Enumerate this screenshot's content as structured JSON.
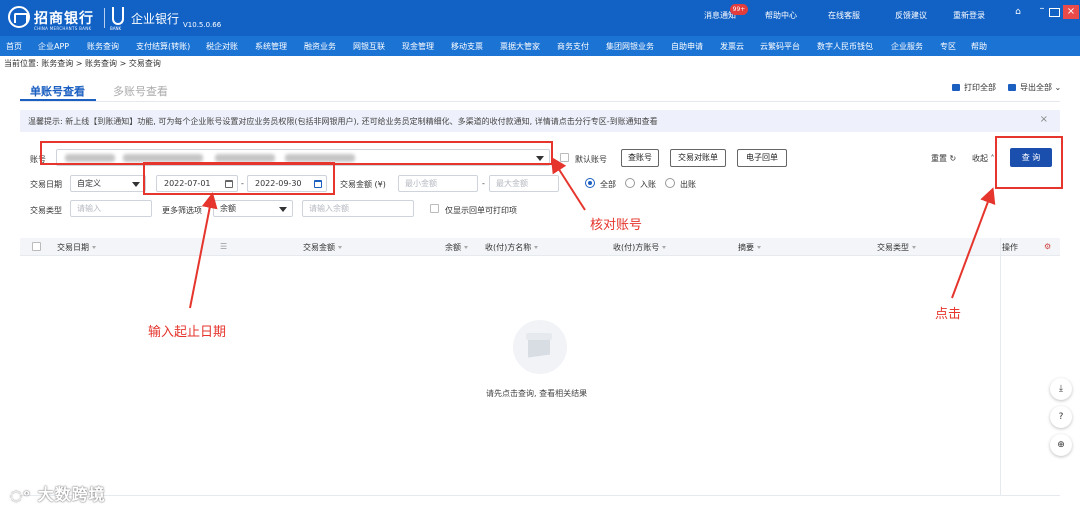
{
  "titlebar": {
    "bank_name": "招商银行",
    "bank_en": "CHINA MERCHANTS BANK",
    "ebank_sub": "BANK",
    "ebank_name": "企业银行",
    "version": "V10.5.0.66",
    "links": [
      "消息通知",
      "帮助中心",
      "在线客服",
      "反馈建议",
      "重新登录"
    ],
    "badge": "99+",
    "colors": {
      "primary": "#1262c6",
      "menu": "#1b73d4"
    }
  },
  "menu": [
    "首页",
    "企业APP",
    "账务查询",
    "支付结算(转账)",
    "税企对账",
    "系统管理",
    "融资业务",
    "网银互联",
    "现金管理",
    "移动支票",
    "票据大管家",
    "商务支付",
    "集团网银业务",
    "自助申请",
    "发票云",
    "云繁码平台",
    "数字人民币钱包",
    "企业服务",
    "专区",
    "帮助"
  ],
  "breadcrumb": "当前位置: 账务查询 > 账务查询 > 交易查询",
  "tabs": {
    "active": "单账号查看",
    "inactive": "多账号查看"
  },
  "tools": {
    "print": "打印全部",
    "export": "导出全部"
  },
  "notice": {
    "text": "温馨提示: 新上线【到账通知】功能, 可为每个企业账号设置对应业务员权限(包括非网银用户), 还可给业务员定制精细化、多渠道的收付款通知, 详情请点击分行专区-到账通知查看",
    "close": "×"
  },
  "filters": {
    "account_label": "账号",
    "default_account": "默认账号",
    "btn_check": "查账号",
    "btn_statement": "交易对账单",
    "btn_receipt": "电子回单",
    "reset": "重置",
    "collapse": "收起",
    "query": "查 询",
    "date_label": "交易日期",
    "date_mode": "自定义",
    "date_start": "2022-07-01",
    "date_end": "2022-09-30",
    "date_sep": "-",
    "amount_label": "交易金额 (¥)",
    "amount_min_placeholder": "最小金额",
    "amount_sep": "-",
    "amount_max_placeholder": "最大金额",
    "radio_all": "全部",
    "radio_in": "入账",
    "radio_out": "出账",
    "type_label": "交易类型",
    "type_placeholder": "请输入",
    "more_label": "更多筛选项",
    "more_select": "余额",
    "balance_placeholder": "请输入余额",
    "receipt_only": "仅显示回单可打印项"
  },
  "annotations": {
    "account": "核对账号",
    "date": "输入起止日期",
    "click": "点击",
    "color": "#e5352c"
  },
  "table": {
    "headers": [
      "交易日期",
      "交易金额",
      "余额",
      "收(付)方名称",
      "收(付)方账号",
      "摘要",
      "交易类型",
      "操作"
    ],
    "empty_text": "请先点击查询, 查看相关结果"
  },
  "watermark": "大数跨境"
}
